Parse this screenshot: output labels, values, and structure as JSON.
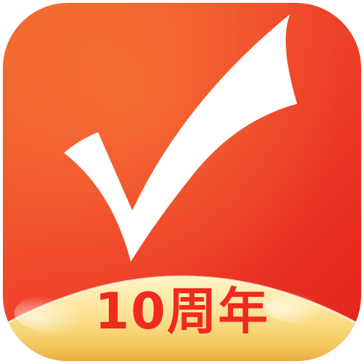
{
  "icon": {
    "name": "checkmark-app-icon",
    "anniversary_label": "10周年",
    "colors": {
      "red_top": "#f25a2c",
      "red_main": "#f0392a",
      "red_deep": "#e01f1a",
      "gold_light": "#fff6c8",
      "gold_mid": "#f7d268",
      "gold_dark": "#e9a83a",
      "check": "#ffffff",
      "label": "#ef2a1e"
    }
  }
}
